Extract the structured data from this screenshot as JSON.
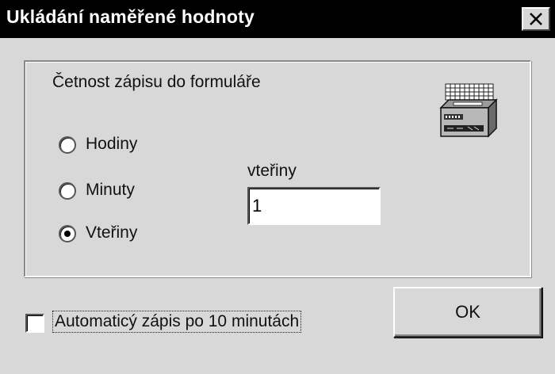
{
  "window": {
    "title": "Ukládání naměřené hodnoty",
    "close_icon": "close-icon"
  },
  "group": {
    "label": "Četnost zápisu do formuláře",
    "icon": "data-logger-device-icon"
  },
  "radios": {
    "hours": "Hodiny",
    "minutes": "Minuty",
    "seconds": "Vteřiny",
    "selected": "Vteřiny"
  },
  "interval": {
    "label": "vteřiny",
    "value": "1"
  },
  "auto_save": {
    "label": "Automaticý zápis po 10 minutách",
    "checked": false
  },
  "buttons": {
    "ok": "OK"
  }
}
